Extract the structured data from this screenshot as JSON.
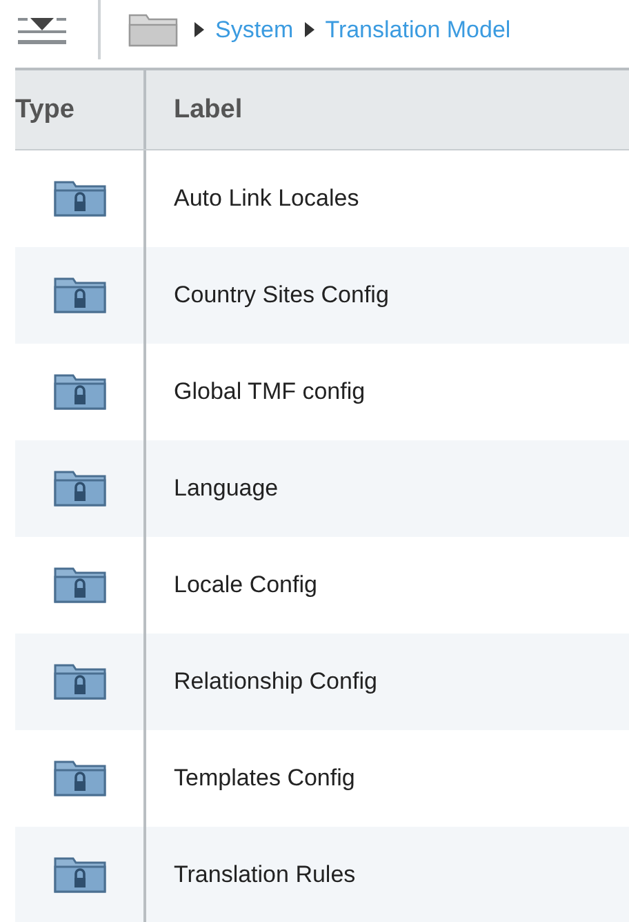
{
  "breadcrumb": [
    {
      "label": "System"
    },
    {
      "label": "Translation Model"
    }
  ],
  "table": {
    "columns": [
      "Type",
      "Label"
    ],
    "rows": [
      {
        "label": "Auto Link Locales"
      },
      {
        "label": "Country Sites Config"
      },
      {
        "label": "Global TMF config"
      },
      {
        "label": "Language"
      },
      {
        "label": "Locale Config"
      },
      {
        "label": "Relationship Config"
      },
      {
        "label": "Templates Config"
      },
      {
        "label": "Translation Rules"
      }
    ]
  }
}
